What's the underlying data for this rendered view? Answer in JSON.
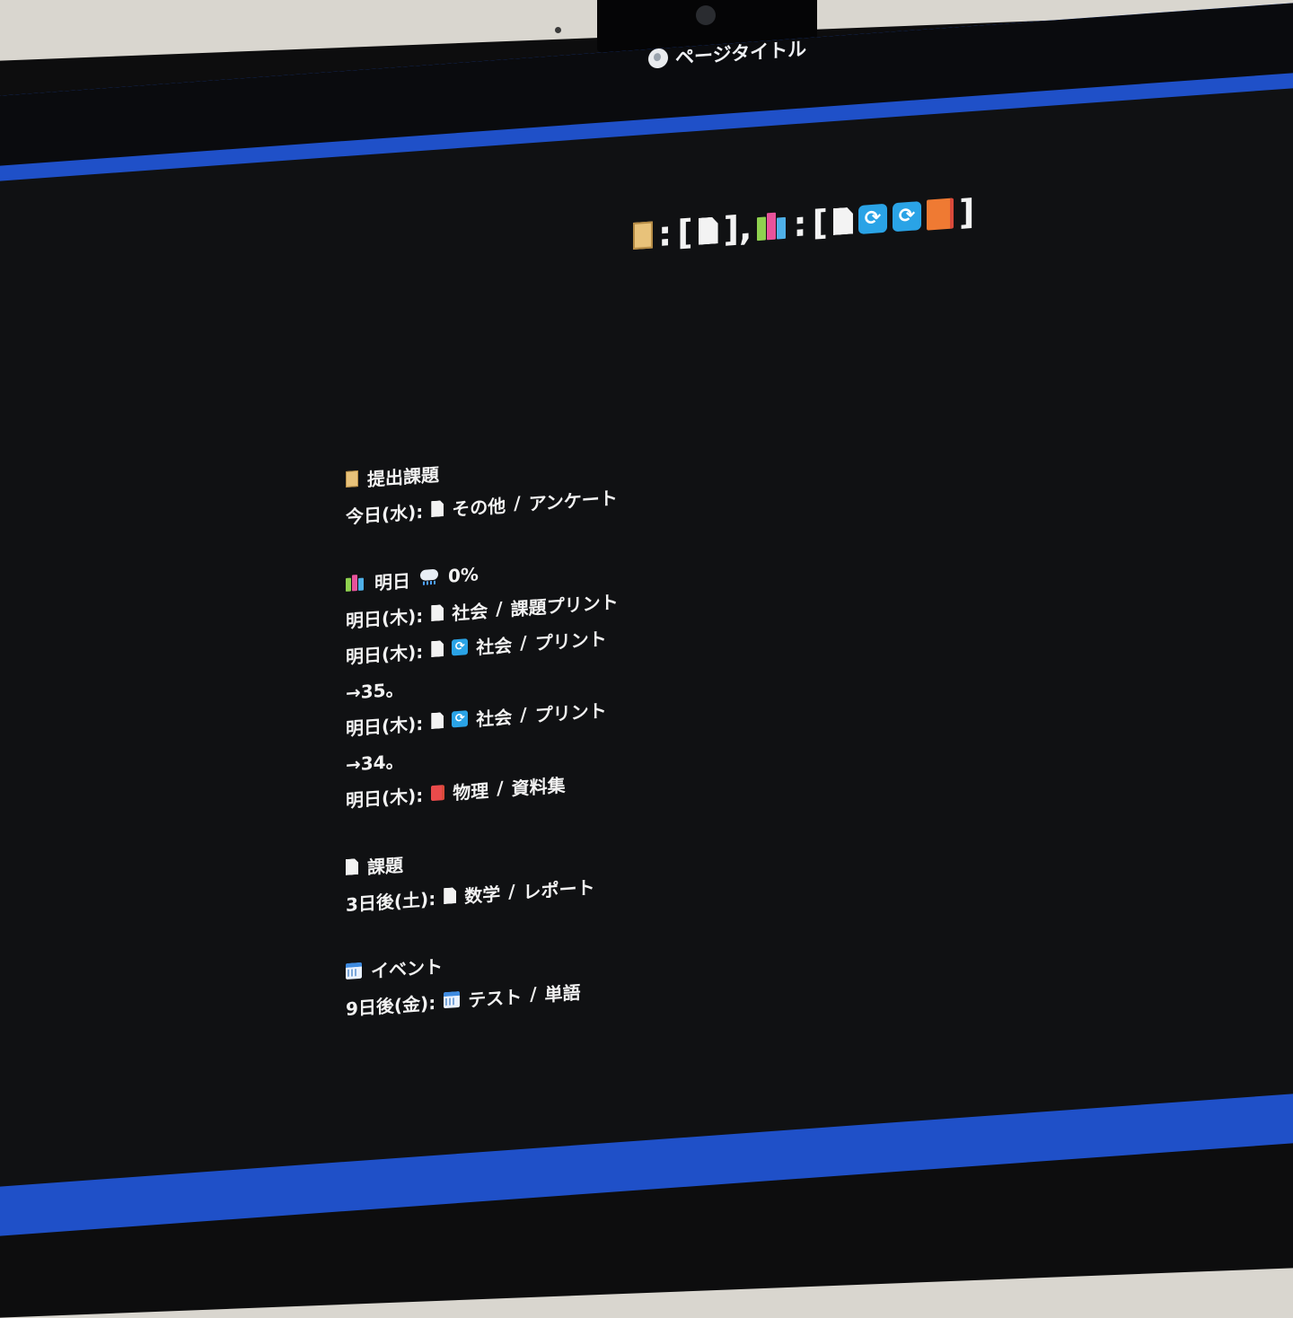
{
  "window": {
    "title": "ページタイトル"
  },
  "legend": {
    "clipboard_icon": "clipboard-icon",
    "colon": ":",
    "open_bracket": "[",
    "close_bracket_comma": "],",
    "close_bracket": "]"
  },
  "sections": {
    "submission": {
      "heading": "提出課題",
      "rows": [
        {
          "label": "今日(水):",
          "subject": "その他",
          "sep": "/",
          "item": "アンケート"
        }
      ]
    },
    "tomorrow": {
      "heading": "明日",
      "rain": "0%",
      "rows": [
        {
          "label": "明日(木):",
          "subject": "社会",
          "sep": "/",
          "item": "課題プリント"
        },
        {
          "label": "明日(木):",
          "subject": "社会",
          "sep": "/",
          "item": "プリント",
          "note": "→35。"
        },
        {
          "label": "明日(木):",
          "subject": "社会",
          "sep": "/",
          "item": "プリント",
          "note": "→34。"
        },
        {
          "label": "明日(木):",
          "subject": "物理",
          "sep": "/",
          "item": "資料集"
        }
      ]
    },
    "assignment": {
      "heading": "課題",
      "rows": [
        {
          "label": "3日後(土):",
          "subject": "数学",
          "sep": "/",
          "item": "レポート"
        }
      ]
    },
    "event": {
      "heading": "イベント",
      "rows": [
        {
          "label": "9日後(金):",
          "subject": "テスト",
          "sep": "/",
          "item": "単語"
        }
      ]
    }
  },
  "colors": {
    "screen_bg": "#101113",
    "frame_blue": "#1f50c8",
    "text": "#f2f2f2",
    "refresh_icon": "#2aa3e6",
    "book_icon": "#ef7a33"
  }
}
